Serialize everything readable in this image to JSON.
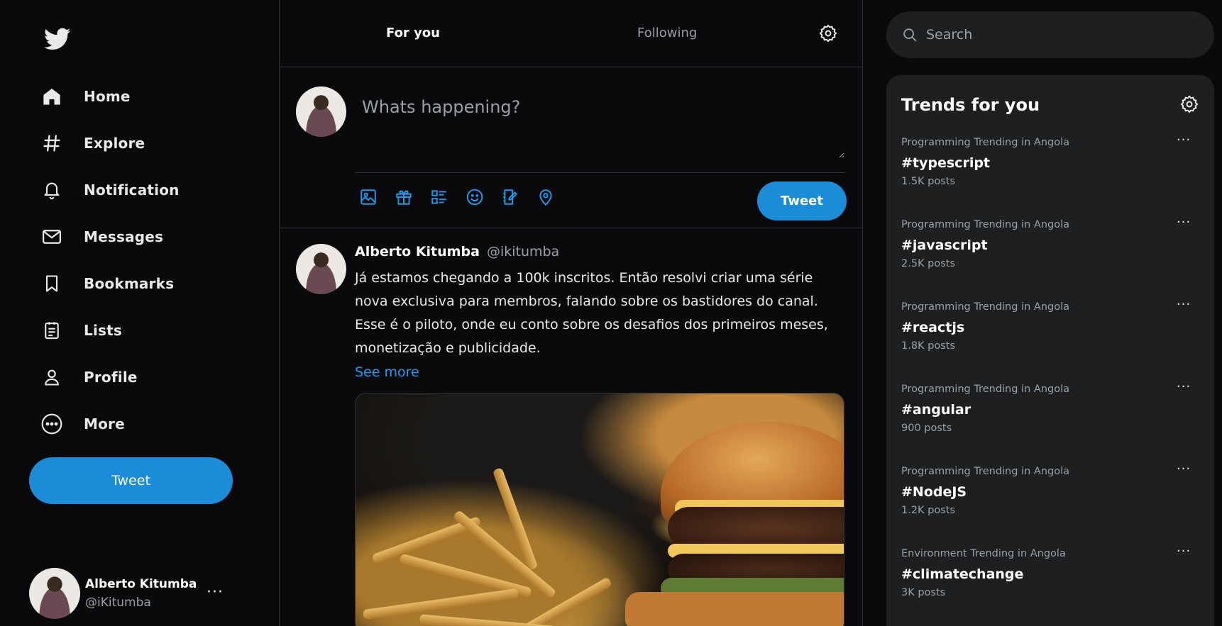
{
  "sidebar": {
    "logo_icon": "twitter-bird-icon",
    "items": [
      {
        "label": "Home",
        "icon": "home-icon"
      },
      {
        "label": "Explore",
        "icon": "hashtag-icon"
      },
      {
        "label": "Notification",
        "icon": "bell-icon"
      },
      {
        "label": "Messages",
        "icon": "mail-icon"
      },
      {
        "label": "Bookmarks",
        "icon": "bookmark-icon"
      },
      {
        "label": "Lists",
        "icon": "list-icon"
      },
      {
        "label": "Profile",
        "icon": "person-icon"
      },
      {
        "label": "More",
        "icon": "more-circle-icon"
      }
    ],
    "tweet_label": "Tweet",
    "account": {
      "name": "Alberto Kitumba",
      "handle": "@iKitumba",
      "more": "···"
    }
  },
  "main": {
    "tabs": [
      {
        "label": "For you"
      },
      {
        "label": "Following"
      }
    ],
    "composer": {
      "placeholder": "Whats happening?",
      "tweet_label": "Tweet",
      "tools": [
        "image-icon",
        "gift-icon",
        "poll-icon",
        "emoji-icon",
        "schedule-icon",
        "location-icon"
      ]
    },
    "post": {
      "name": "Alberto Kitumba",
      "handle": "@ikitumba",
      "text": "Já estamos chegando a 100k inscritos. Então resolvi criar uma série nova exclusiva para membros, falando sobre os bastidores do canal. Esse é o piloto, onde eu conto sobre os desafios dos primeiros meses, monetização e publicidade.",
      "see_more": "See more"
    }
  },
  "right": {
    "search_placeholder": "Search",
    "trends_title": "Trends for you",
    "trends": [
      {
        "context": "Programming Trending in Angola",
        "tag": "#typescript",
        "count": "1.5K posts"
      },
      {
        "context": "Programming Trending in Angola",
        "tag": "#javascript",
        "count": "2.5K posts"
      },
      {
        "context": "Programming Trending in Angola",
        "tag": "#reactjs",
        "count": "1.8K posts"
      },
      {
        "context": "Programming Trending in Angola",
        "tag": "#angular",
        "count": "900 posts"
      },
      {
        "context": "Programming Trending in Angola",
        "tag": "#NodeJS",
        "count": "1.2K posts"
      },
      {
        "context": "Environment Trending in Angola",
        "tag": "#climatechange",
        "count": "3K posts"
      }
    ],
    "more": "···"
  },
  "colors": {
    "accent": "#1d8cd8",
    "background": "#0a0a0c",
    "panel": "#1e1f21",
    "muted": "#9aa0a6"
  }
}
